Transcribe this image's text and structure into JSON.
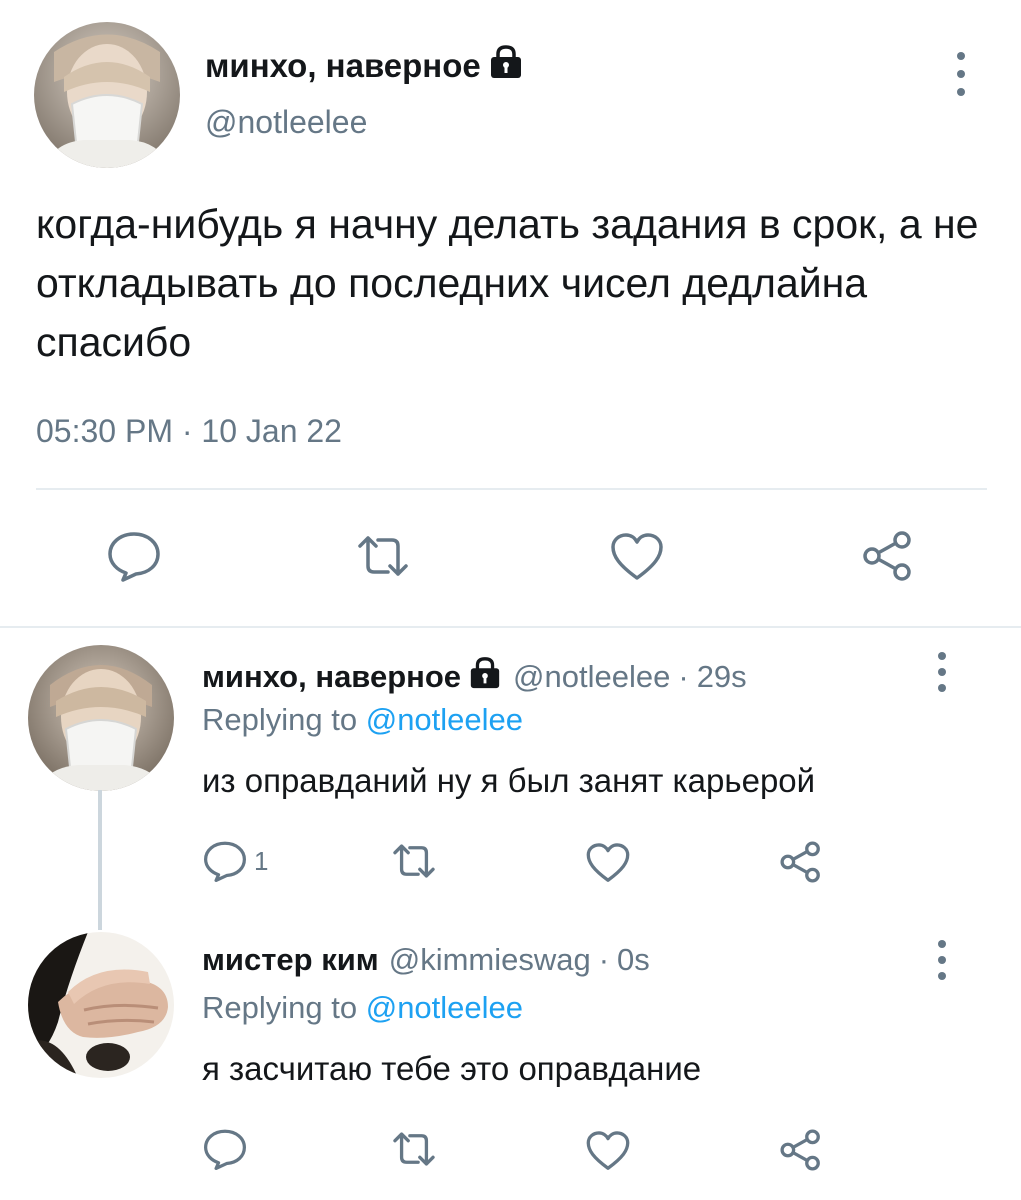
{
  "main_tweet": {
    "display_name": "минхо, наверное",
    "handle": "@notleelee",
    "text": "когда-нибудь я начну делать задания в срок, а не откладывать до последних чисел дедлайна спасибо",
    "time": "05:30 PM",
    "separator": "·",
    "date": "10 Jan 22",
    "icons": {
      "lock": "lock-icon",
      "more": "more-vertical-icon",
      "reply": "reply-icon",
      "retweet": "retweet-icon",
      "like": "heart-icon",
      "share": "share-icon"
    }
  },
  "replies": [
    {
      "display_name": "минхо, наверное",
      "handle": "@notleelee",
      "dot": "·",
      "age": "29s",
      "replying_prefix": "Replying to",
      "replying_to": "@notleelee",
      "text": "из оправданий ну я был занят карьерой",
      "reply_count": "1"
    },
    {
      "display_name": "мистер ким",
      "handle": "@kimmieswag",
      "dot": "·",
      "age": "0s",
      "replying_prefix": "Replying to",
      "replying_to": "@notleelee",
      "text": "я засчитаю тебе это оправдание",
      "reply_count": ""
    }
  ],
  "colors": {
    "text_primary": "#14171a",
    "text_secondary": "#657786",
    "link": "#1da1f2",
    "divider": "#e6ecf0",
    "thread_line": "#ccd6dd"
  }
}
